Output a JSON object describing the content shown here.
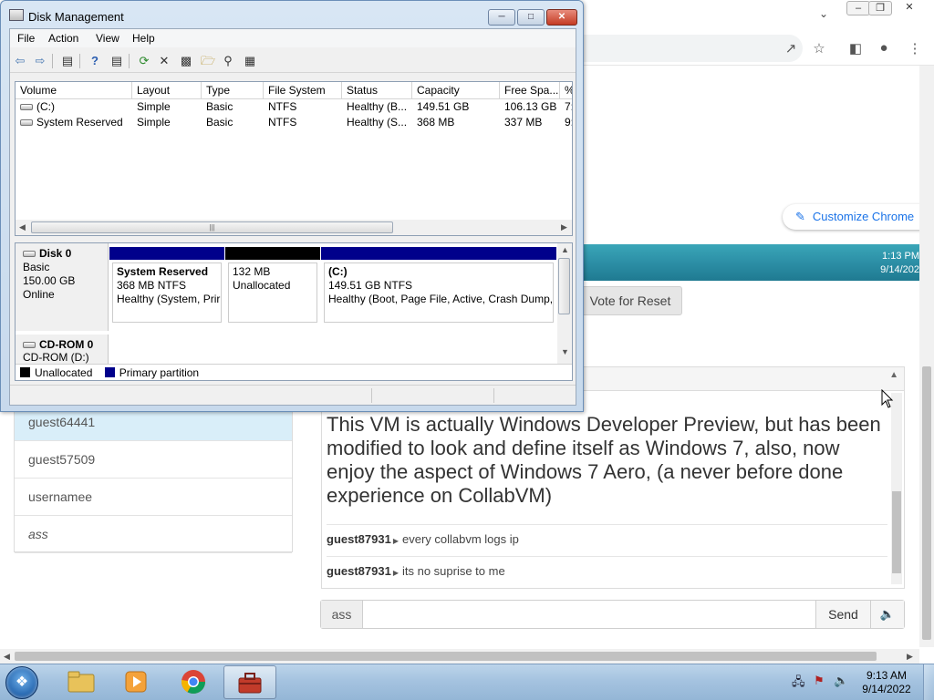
{
  "dm": {
    "title": "Disk Management",
    "menu": [
      "File",
      "Action",
      "View",
      "Help"
    ],
    "columns": [
      "Volume",
      "Layout",
      "Type",
      "File System",
      "Status",
      "Capacity",
      "Free Spa...",
      "%"
    ],
    "rows": [
      {
        "volume": "(C:)",
        "layout": "Simple",
        "type": "Basic",
        "fs": "NTFS",
        "status": "Healthy (B...",
        "capacity": "149.51 GB",
        "free": "106.13 GB",
        "pct": "7:"
      },
      {
        "volume": "System Reserved",
        "layout": "Simple",
        "type": "Basic",
        "fs": "NTFS",
        "status": "Healthy (S...",
        "capacity": "368 MB",
        "free": "337 MB",
        "pct": "9:"
      }
    ],
    "disk0": {
      "name": "Disk 0",
      "type": "Basic",
      "size": "150.00 GB",
      "state": "Online"
    },
    "partitions": [
      {
        "name": "System Reserved",
        "size": "368 MB NTFS",
        "status": "Healthy (System, Prir",
        "color": "#00008b"
      },
      {
        "name": "",
        "size": "132 MB",
        "status": "Unallocated",
        "color": "#000000"
      },
      {
        "name": "(C:)",
        "size": "149.51 GB NTFS",
        "status": "Healthy (Boot, Page File, Active, Crash Dump,",
        "color": "#00008b"
      }
    ],
    "cdrom": {
      "name": "CD-ROM 0",
      "partial": "CD-ROM (D:)"
    },
    "legend": [
      {
        "label": "Unallocated",
        "color": "#000000"
      },
      {
        "label": "Primary partition",
        "color": "#00008b"
      }
    ]
  },
  "chrome": {
    "customize": "Customize Chrome",
    "vm_clock": {
      "time": "1:13 PM",
      "date": "9/14/202"
    },
    "vote_button": "Vote for Reset"
  },
  "users": [
    "guest64441",
    "guest57509",
    "usernamee",
    "ass"
  ],
  "chat": {
    "motd": "This VM is actually Windows Developer Preview, but has been modified to look and define itself as Windows 7, also, now enjoy the aspect of Windows 7 Aero, (a never before done experience on CollabVM)",
    "messages": [
      {
        "user": "guest87931",
        "text": "every collabvm logs ip"
      },
      {
        "user": "guest87931",
        "text": "its no suprise to me"
      }
    ],
    "username": "ass",
    "input_placeholder": "",
    "send_label": "Send"
  },
  "taskbar": {
    "apps": [
      "windows-explorer",
      "media-player",
      "chrome",
      "toolbox"
    ],
    "clock": {
      "time": "9:13 AM",
      "date": "9/14/2022"
    }
  }
}
